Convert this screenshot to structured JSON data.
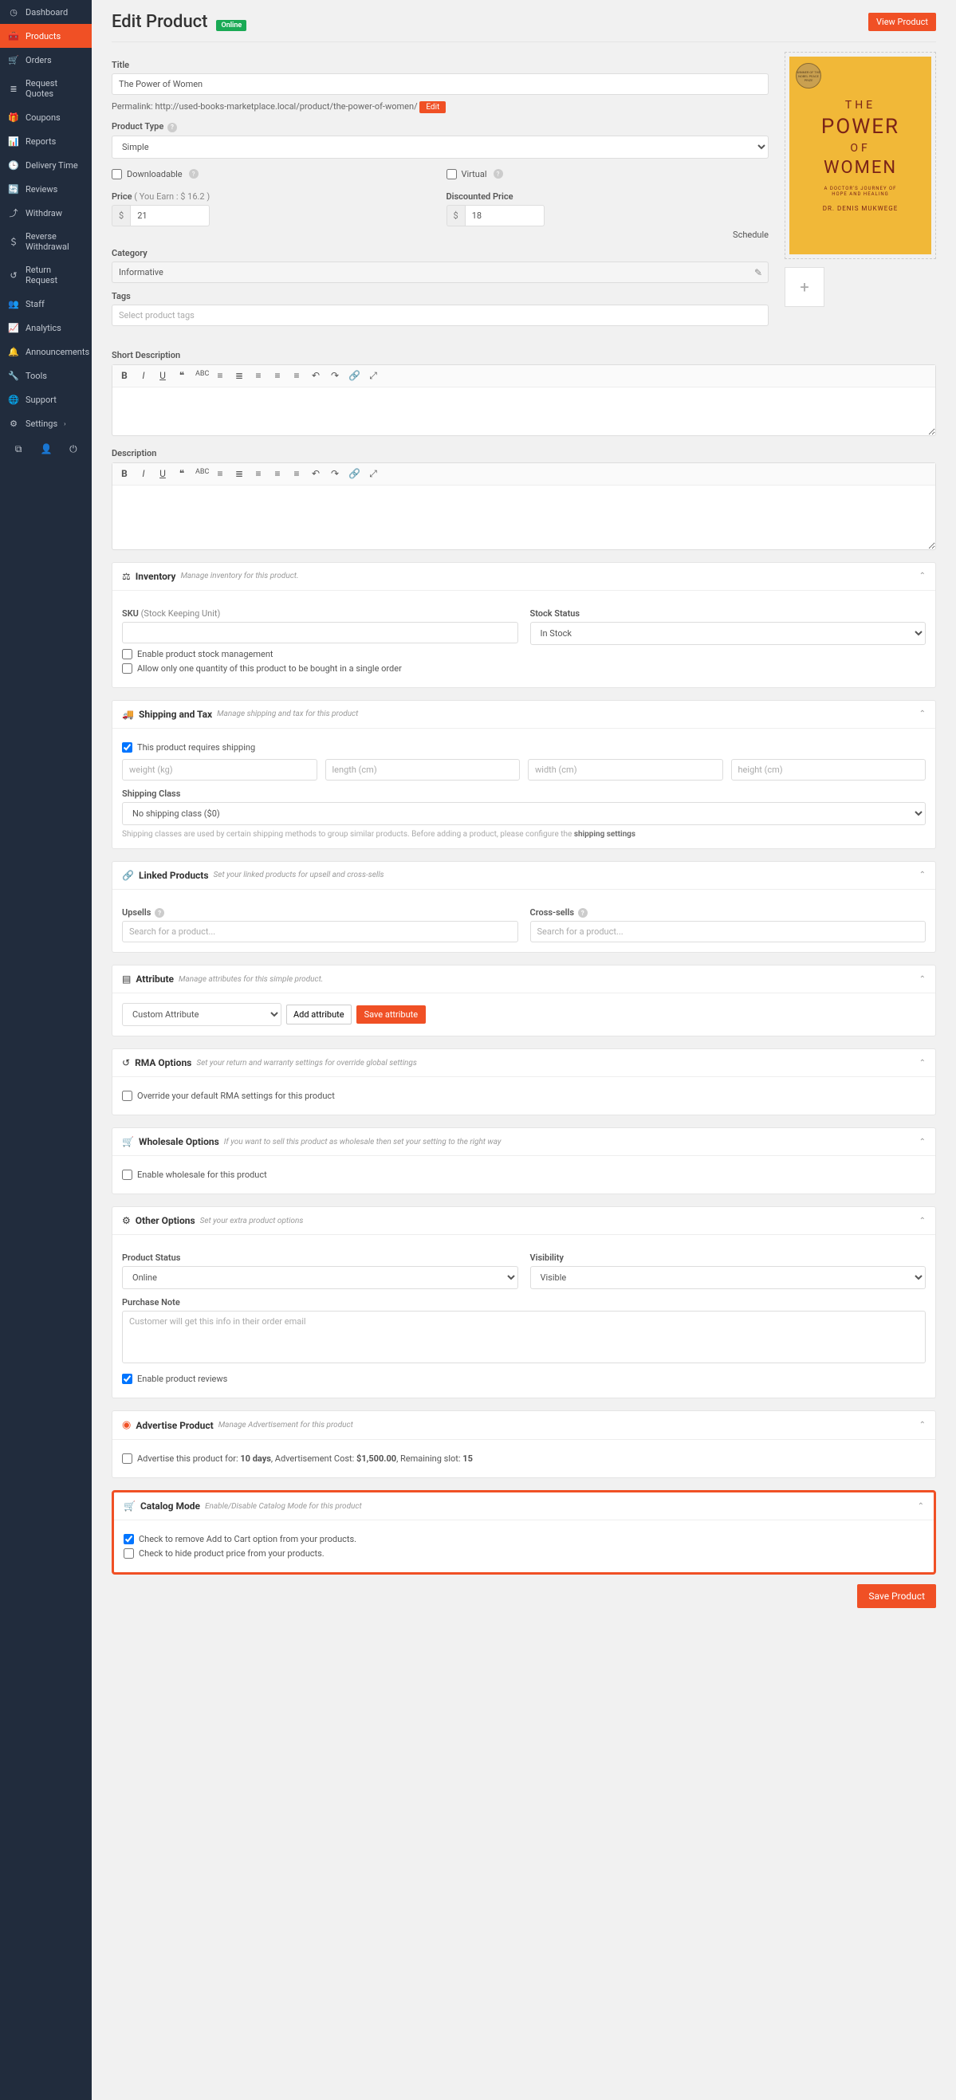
{
  "sidebar": {
    "items": [
      {
        "label": "Dashboard",
        "icon": "dashboard"
      },
      {
        "label": "Products",
        "icon": "box",
        "active": true
      },
      {
        "label": "Orders",
        "icon": "cart"
      },
      {
        "label": "Request Quotes",
        "icon": "list"
      },
      {
        "label": "Coupons",
        "icon": "gift"
      },
      {
        "label": "Reports",
        "icon": "chart"
      },
      {
        "label": "Delivery Time",
        "icon": "clock"
      },
      {
        "label": "Reviews",
        "icon": "refresh"
      },
      {
        "label": "Withdraw",
        "icon": "upload"
      },
      {
        "label": "Reverse Withdrawal",
        "icon": "dollar"
      },
      {
        "label": "Return Request",
        "icon": "undo"
      },
      {
        "label": "Staff",
        "icon": "users"
      },
      {
        "label": "Analytics",
        "icon": "bars"
      },
      {
        "label": "Announcements",
        "icon": "bell"
      },
      {
        "label": "Tools",
        "icon": "wrench"
      },
      {
        "label": "Support",
        "icon": "globe"
      },
      {
        "label": "Settings",
        "icon": "gear",
        "caret": true
      }
    ]
  },
  "header": {
    "title": "Edit Product",
    "status": "Online",
    "view_btn": "View Product"
  },
  "title": {
    "label": "Title",
    "value": "The Power of Women"
  },
  "permalink": {
    "label": "Permalink:",
    "url": "http://used-books-marketplace.local/product/the-power-of-women/",
    "edit": "Edit"
  },
  "product_type": {
    "label": "Product Type",
    "value": "Simple"
  },
  "downloadable": "Downloadable",
  "virtual": "Virtual",
  "price": {
    "label": "Price",
    "hint": "( You Earn : $ 16.2 )",
    "value": "21"
  },
  "discount": {
    "label": "Discounted Price",
    "value": "18"
  },
  "schedule": "Schedule",
  "category": {
    "label": "Category",
    "value": "Informative"
  },
  "tags": {
    "label": "Tags",
    "placeholder": "Select product tags"
  },
  "short_desc": "Short Description",
  "desc": "Description",
  "cover": {
    "the": "THE",
    "power": "POWER",
    "of": "OF",
    "women": "WOMEN",
    "sub1": "A DOCTOR'S JOURNEY OF",
    "sub2": "HOPE AND HEALING",
    "author": "DR. DENIS MUKWEGE",
    "nobel": "WINNER OF THE NOBEL PEACE PRIZE"
  },
  "inventory": {
    "title": "Inventory",
    "sub": "Manage inventory for this product.",
    "sku_label": "SKU",
    "sku_hint": "(Stock Keeping Unit)",
    "stock_label": "Stock Status",
    "stock_value": "In Stock",
    "chk1": "Enable product stock management",
    "chk2": "Allow only one quantity of this product to be bought in a single order"
  },
  "shipping": {
    "title": "Shipping and Tax",
    "sub": "Manage shipping and tax for this product",
    "chk": "This product requires shipping",
    "w": "weight (kg)",
    "l": "length (cm)",
    "wi": "width (cm)",
    "h": "height (cm)",
    "class_label": "Shipping Class",
    "class_value": "No shipping class ($0)",
    "help1": "Shipping classes are used by certain shipping methods to group similar products. Before adding a product, please configure the ",
    "help_link": "shipping settings"
  },
  "linked": {
    "title": "Linked Products",
    "sub": "Set your linked products for upsell and cross-sells",
    "up": "Upsells",
    "cross": "Cross-sells",
    "ph": "Search for a product..."
  },
  "attribute": {
    "title": "Attribute",
    "sub": "Manage attributes for this simple product.",
    "select": "Custom Attribute",
    "add": "Add attribute",
    "save": "Save attribute"
  },
  "rma": {
    "title": "RMA Options",
    "sub": "Set your return and warranty settings for override global settings",
    "chk": "Override your default RMA settings for this product"
  },
  "wholesale": {
    "title": "Wholesale Options",
    "sub": "If you want to sell this product as wholesale then set your setting to the right way",
    "chk": "Enable wholesale for this product"
  },
  "other": {
    "title": "Other Options",
    "sub": "Set your extra product options",
    "status_label": "Product Status",
    "status_value": "Online",
    "vis_label": "Visibility",
    "vis_value": "Visible",
    "note_label": "Purchase Note",
    "note_ph": "Customer will get this info in their order email",
    "chk": "Enable product reviews"
  },
  "advertise": {
    "title": "Advertise Product",
    "sub": "Manage Advertisement for this product",
    "text1": "Advertise this product for: ",
    "days": "10 days",
    "text2": ", Advertisement Cost: ",
    "cost": "$1,500.00",
    "text3": ", Remaining slot: ",
    "slot": "15"
  },
  "catalog": {
    "title": "Catalog Mode",
    "sub": "Enable/Disable Catalog Mode for this product",
    "chk1": "Check to remove Add to Cart option from your products.",
    "chk2": "Check to hide product price from your products."
  },
  "save": "Save Product",
  "currency": "$"
}
